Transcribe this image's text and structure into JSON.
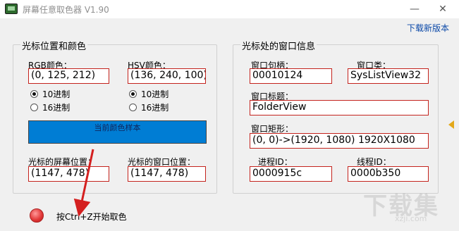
{
  "window": {
    "title": "屏幕任意取色器 V1.90",
    "minimize_glyph": "—",
    "close_glyph": "✕"
  },
  "download_link": "下载新版本",
  "color_group": {
    "title": "光标位置和颜色",
    "rgb_label": "RGB颜色：",
    "rgb_value": "(0, 125, 212)",
    "hsv_label": "HSV颜色：",
    "hsv_value": "(136, 240, 100)",
    "rgb_radios": [
      {
        "label": "10进制",
        "checked": true
      },
      {
        "label": "16进制",
        "checked": false
      }
    ],
    "hsv_radios": [
      {
        "label": "10进制",
        "checked": true
      },
      {
        "label": "16进制",
        "checked": false
      }
    ],
    "swatch_label": "当前颜色样本",
    "swatch_color": "#007dd4",
    "screen_pos_label": "光标的屏幕位置：",
    "screen_pos_value": "(1147, 478)",
    "window_pos_label": "光标的窗口位置：",
    "window_pos_value": "(1147, 478)"
  },
  "window_group": {
    "title": "光标处的窗口信息",
    "handle_label": "窗口句柄：",
    "handle_value": "00010124",
    "class_label": "窗口类：",
    "class_value": "SysListView32",
    "title_label": "窗口标题：",
    "title_value": "FolderView",
    "rect_label": "窗口矩形：",
    "rect_value": "(0, 0)->(1920, 1080) 1920X1080",
    "pid_label": "进程ID：",
    "pid_value": "0000915c",
    "tid_label": "线程ID：",
    "tid_value": "0000b350"
  },
  "hint": "按Ctrl+Z开始取色",
  "accent_colors": {
    "field_border": "#c4231d",
    "link": "#0b49a8",
    "annotation_arrow": "#d42020"
  },
  "watermark": {
    "main": "下载集",
    "sub": "xzji.com"
  }
}
